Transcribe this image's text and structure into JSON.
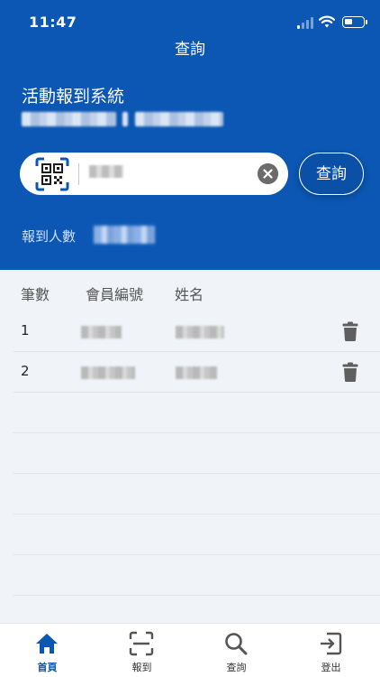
{
  "status_bar": {
    "time": "11:47"
  },
  "header": {
    "nav_title": "查詢",
    "system_title": "活動報到系統"
  },
  "search": {
    "placeholder": "",
    "query_button": "查詢"
  },
  "checkin": {
    "count_label": "報到人數"
  },
  "table": {
    "headers": [
      "筆數",
      "會員編號",
      "姓名"
    ],
    "rows": [
      {
        "index": "1"
      },
      {
        "index": "2"
      }
    ]
  },
  "tabbar": {
    "items": [
      {
        "label": "首頁",
        "icon": "home-icon",
        "active": true
      },
      {
        "label": "報到",
        "icon": "scan-icon",
        "active": false
      },
      {
        "label": "查詢",
        "icon": "search-icon",
        "active": false
      },
      {
        "label": "登出",
        "icon": "logout-icon",
        "active": false
      }
    ]
  },
  "colors": {
    "header_bg": "#0b57b3",
    "accent": "#0b57b3",
    "page_bg": "#f0f4f8"
  }
}
